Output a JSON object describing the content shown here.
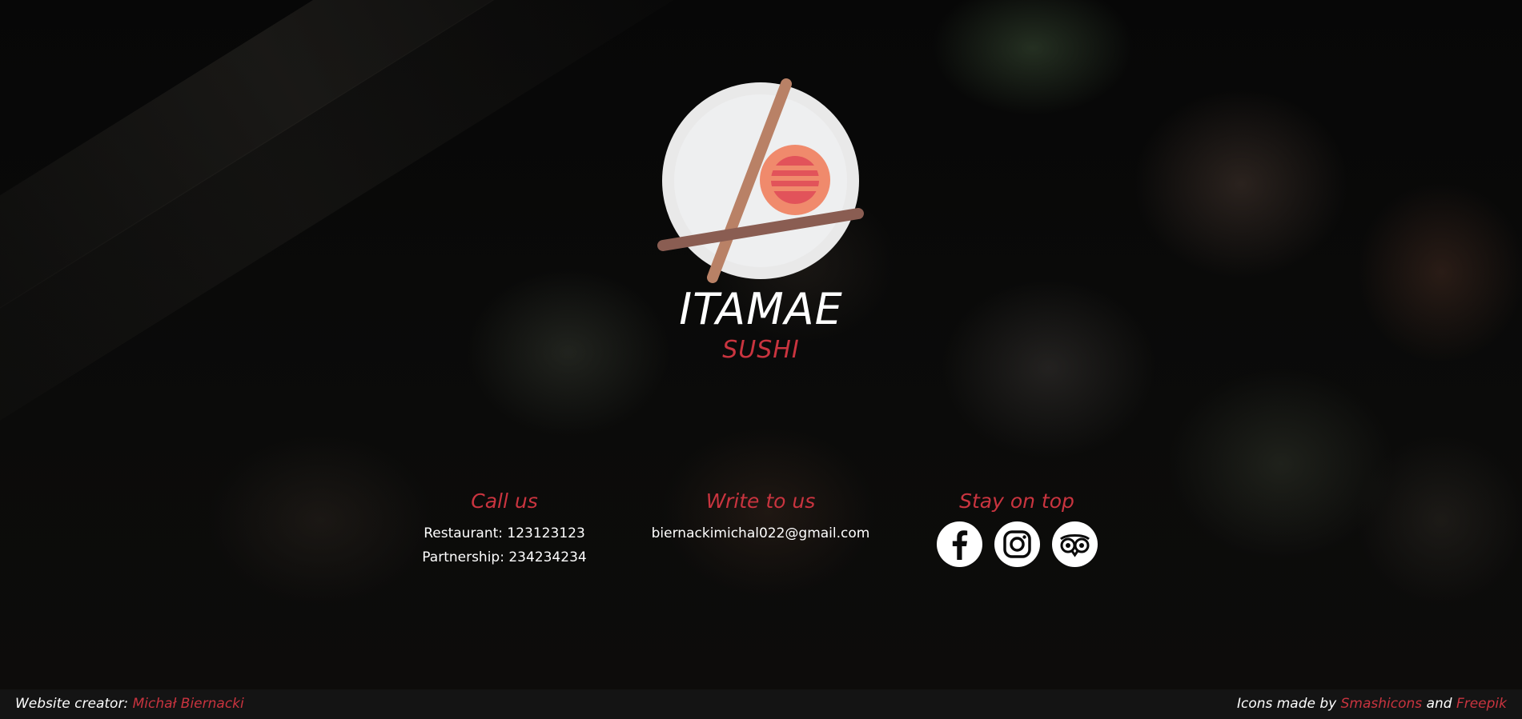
{
  "brand": {
    "name": "ITAMAE",
    "subtitle": "SUSHI"
  },
  "contact": {
    "call": {
      "heading": "Call us",
      "lines": [
        "Restaurant: 123123123",
        "Partnership: 234234234"
      ]
    },
    "write": {
      "heading": "Write to us",
      "email": "biernackimichal022@gmail.com"
    },
    "social": {
      "heading": "Stay on top",
      "icons": [
        "facebook-icon",
        "instagram-icon",
        "tripadvisor-icon"
      ]
    }
  },
  "footer": {
    "creator_label": "Website creator:",
    "creator_name": "Michał Biernacki",
    "icons_label": "Icons made by",
    "icons_author1": "Smashicons",
    "and_text": "and",
    "icons_author2": "Freepik"
  },
  "colors": {
    "accent": "#c9343f",
    "footer_bg": "#141414",
    "text": "#ffffff"
  }
}
